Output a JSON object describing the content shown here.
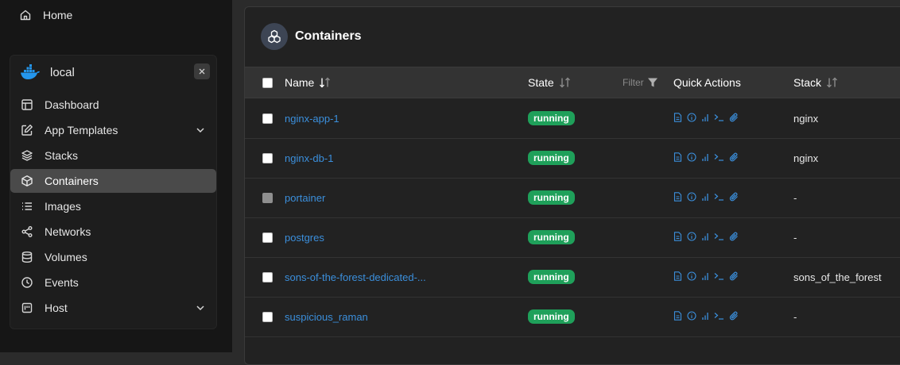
{
  "sidebar": {
    "home_label": "Home",
    "environment": {
      "name": "local"
    },
    "items": [
      {
        "label": "Dashboard",
        "icon": "layout-icon",
        "active": false
      },
      {
        "label": "App Templates",
        "icon": "edit-icon",
        "active": false,
        "expandable": true
      },
      {
        "label": "Stacks",
        "icon": "layers-icon",
        "active": false
      },
      {
        "label": "Containers",
        "icon": "box-icon",
        "active": true
      },
      {
        "label": "Images",
        "icon": "list-icon",
        "active": false
      },
      {
        "label": "Networks",
        "icon": "share-icon",
        "active": false
      },
      {
        "label": "Volumes",
        "icon": "database-icon",
        "active": false
      },
      {
        "label": "Events",
        "icon": "clock-icon",
        "active": false
      },
      {
        "label": "Host",
        "icon": "server-icon",
        "active": false,
        "expandable": true
      }
    ]
  },
  "main": {
    "title": "Containers",
    "columns": {
      "name": "Name",
      "state": "State",
      "filter": "Filter",
      "quick_actions": "Quick Actions",
      "stack": "Stack"
    },
    "rows": [
      {
        "name": "nginx-app-1",
        "state": "running",
        "stack": "nginx",
        "checkbox_disabled": false
      },
      {
        "name": "nginx-db-1",
        "state": "running",
        "stack": "nginx",
        "checkbox_disabled": false
      },
      {
        "name": "portainer",
        "state": "running",
        "stack": "-",
        "checkbox_disabled": true
      },
      {
        "name": "postgres",
        "state": "running",
        "stack": "-",
        "checkbox_disabled": false
      },
      {
        "name": "sons-of-the-forest-dedicated-...",
        "state": "running",
        "stack": "sons_of_the_forest",
        "checkbox_disabled": false
      },
      {
        "name": "suspicious_raman",
        "state": "running",
        "stack": "-",
        "checkbox_disabled": false
      }
    ],
    "quick_action_icons": [
      "logs-icon",
      "inspect-icon",
      "stats-icon",
      "console-icon",
      "attach-icon"
    ]
  },
  "colors": {
    "sidebar_bg": "#161616",
    "content_bg": "#2b2b2b",
    "panel_bg": "#222222",
    "active_nav": "#4a4a4a",
    "link": "#3b8fdc",
    "running_badge": "#1fa05a",
    "docker_blue": "#2496ed"
  }
}
